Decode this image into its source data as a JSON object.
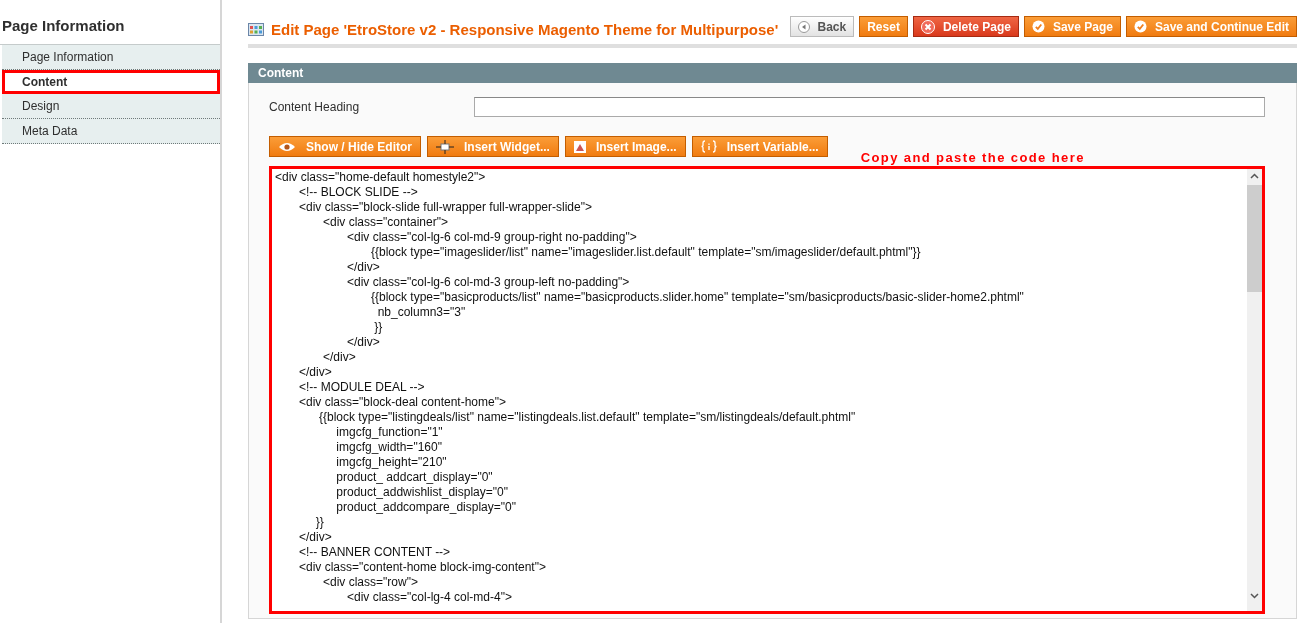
{
  "sidebar": {
    "title": "Page Information",
    "items": [
      {
        "label": "Page Information",
        "selected": false
      },
      {
        "label": "Content",
        "selected": true
      },
      {
        "label": "Design",
        "selected": false
      },
      {
        "label": "Meta Data",
        "selected": false
      }
    ]
  },
  "header": {
    "title": "Edit Page 'EtroStore v2 - Responsive Magento Theme for Multipurpose'",
    "buttons": [
      {
        "label": "Back",
        "kind": "back"
      },
      {
        "label": "Reset",
        "kind": "plain"
      },
      {
        "label": "Delete Page",
        "kind": "delete"
      },
      {
        "label": "Save Page",
        "kind": "save"
      },
      {
        "label": "Save and Continue Edit",
        "kind": "save"
      }
    ]
  },
  "section": {
    "title": "Content",
    "content_heading": {
      "label": "Content Heading"
    },
    "editor_buttons": [
      {
        "label": "Show / Hide Editor",
        "kind": "eye"
      },
      {
        "label": "Insert Widget...",
        "kind": "widget"
      },
      {
        "label": "Insert Image...",
        "kind": "image"
      },
      {
        "label": "Insert Variable...",
        "kind": "variable"
      }
    ],
    "annotation": "Copy and paste the code here",
    "code": "<div class=\"home-default homestyle2\">\n\t<!-- BLOCK SLIDE -->\n\t<div class=\"block-slide full-wrapper full-wrapper-slide\">\n\t\t<div class=\"container\">\n\t\t\t<div class=\"col-lg-6 col-md-9 group-right no-padding\">\n\t\t\t\t{{block type=\"imageslider/list\" name=\"imageslider.list.default\" template=\"sm/imageslider/default.phtml\"}}\n\t\t\t</div>\n\t\t\t<div class=\"col-lg-6 col-md-3 group-left no-padding\">\n\t\t\t\t{{block type=\"basicproducts/list\" name=\"basicproducts.slider.home\" template=\"sm/basicproducts/basic-slider-home2.phtml\"\n\t\t\t\t  nb_column3=\"3\"\n\t\t\t\t }}\n\t\t\t</div>\n\t\t</div>\n\t</div>\n\t<!-- MODULE DEAL -->\n\t<div class=\"block-deal content-home\">\n\t      {{block type=\"listingdeals/list\" name=\"listingdeals.list.default\" template=\"sm/listingdeals/default.phtml\"\n\t\t    imgcfg_function=\"1\"\n\t\t    imgcfg_width=\"160\"\n\t\t    imgcfg_height=\"210\"\n\t\t    product_ addcart_display=\"0\"\n\t\t    product_addwishlist_display=\"0\"\n\t\t    product_addcompare_display=\"0\"\n\t     }}\n\t</div>\n\t<!-- BANNER CONTENT -->\n\t<div class=\"content-home block-img-content\">\n\t\t<div class=\"row\">\n\t\t\t<div class=\"col-lg-4 col-md-4\">"
  }
}
